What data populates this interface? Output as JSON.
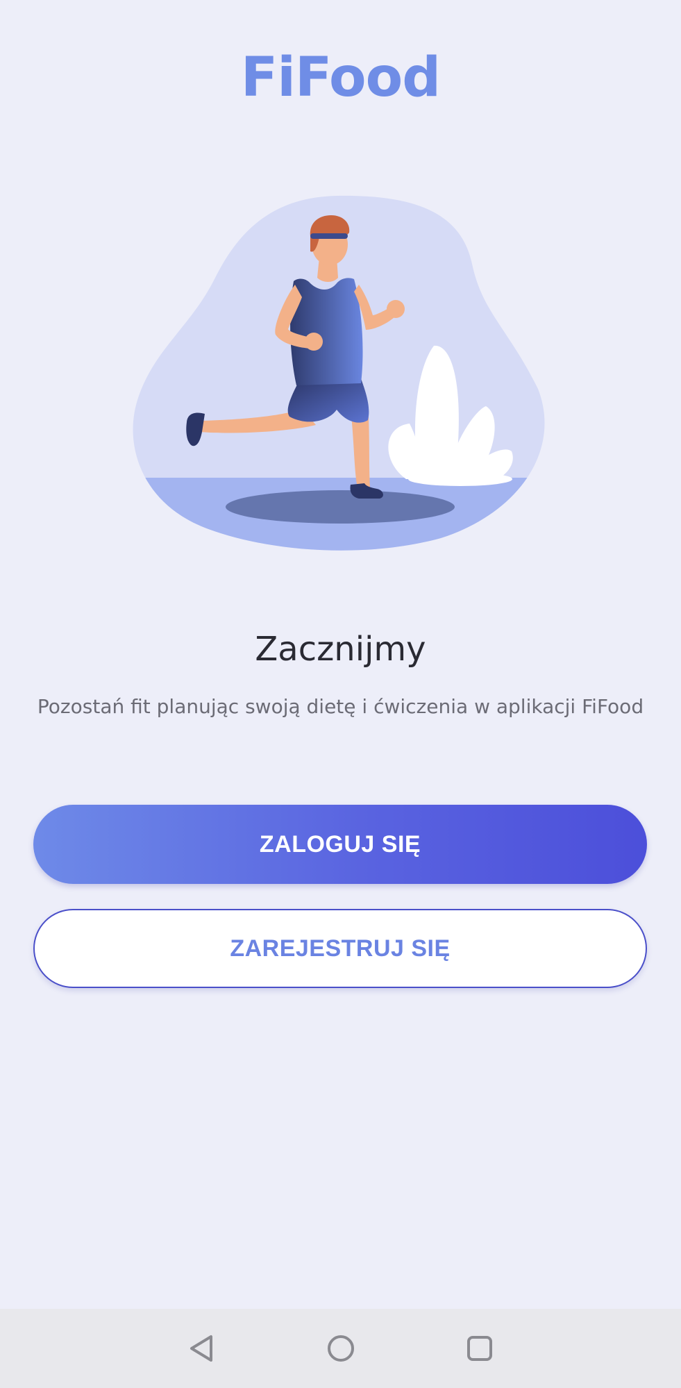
{
  "app": {
    "title": "FiFood"
  },
  "hero": {
    "illustration": "running-person-illustration"
  },
  "welcome": {
    "heading": "Zacznijmy",
    "subtitle": "Pozostań fit planując swoją dietę i ćwiczenia w aplikacji FiFood"
  },
  "actions": {
    "login_label": "ZALOGUJ SIĘ",
    "register_label": "ZAREJESTRUJ SIĘ"
  },
  "navbar": {
    "back_icon": "back-triangle-icon",
    "home_icon": "home-circle-icon",
    "recents_icon": "recents-square-icon"
  },
  "colors": {
    "background": "#edeef9",
    "brand": "#6f8de6",
    "button_gradient_start": "#6e8ae8",
    "button_gradient_end": "#4c4fda",
    "outline": "#4a4fc9"
  }
}
